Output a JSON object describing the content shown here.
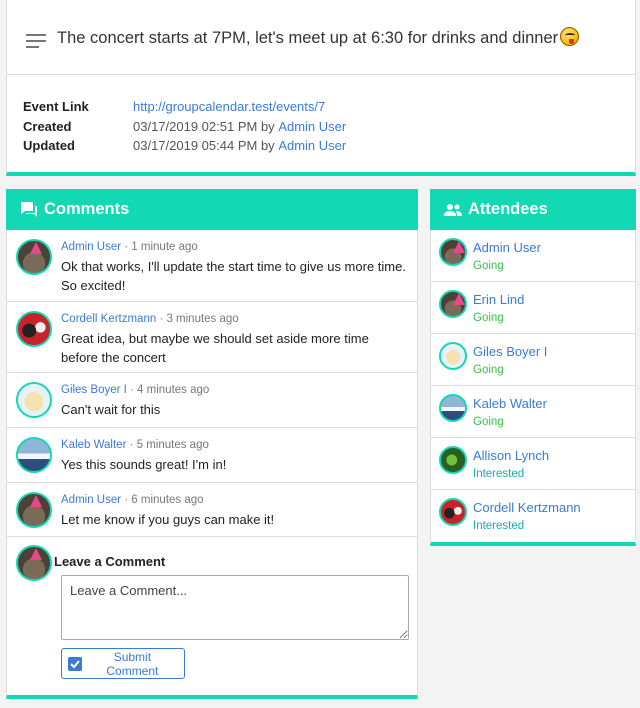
{
  "event": {
    "description": "The concert starts at 7PM, let's meet up at 6:30 for drinks and dinner",
    "details": [
      {
        "label": "Event Link",
        "value": "http://groupcalendar.test/events/7"
      },
      {
        "label": "Created",
        "date": "03/17/2019 02:51 PM",
        "by": "by",
        "user": "Admin User"
      },
      {
        "label": "Updated",
        "date": "03/17/2019 05:44 PM",
        "by": "by",
        "user": "Admin User"
      }
    ]
  },
  "comments": {
    "title": "Comments",
    "items": [
      {
        "author": "Admin User",
        "time": " · 1 minute ago",
        "text": "Ok that works, I'll update the start time to give us more time. So excited!",
        "avatar": "cat-icon"
      },
      {
        "author": "Cordell Kertzmann",
        "time": " · 3 minutes ago",
        "text": "Great idea, but maybe we should set aside more time before the concert",
        "avatar": "red-icon"
      },
      {
        "author": "Giles Boyer I",
        "time": " · 4 minutes ago",
        "text": "Can't wait for this",
        "avatar": "dog-icon"
      },
      {
        "author": "Kaleb Walter",
        "time": " · 5 minutes ago",
        "text": "Yes this sounds great! I'm in!",
        "avatar": "boat-icon"
      },
      {
        "author": "Admin User",
        "time": " · 6 minutes ago",
        "text": "Let me know if you guys can make it!",
        "avatar": "cat-icon"
      }
    ],
    "leave_title": "Leave a Comment",
    "placeholder": "Leave a Comment...",
    "submit_label": "Submit Comment"
  },
  "attendees": {
    "title": "Attendees",
    "items": [
      {
        "name": "Admin User",
        "status": "Going"
      },
      {
        "name": "Erin Lind",
        "status": "Going"
      },
      {
        "name": "Giles Boyer I",
        "status": "Going"
      },
      {
        "name": "Kaleb Walter",
        "status": "Going"
      },
      {
        "name": "Allison Lynch",
        "status": "Interested"
      },
      {
        "name": "Cordell Kertzmann",
        "status": "Interested"
      }
    ]
  },
  "colors": {
    "accent": "#12d8b4",
    "link": "#3a7bd5",
    "going": "#3cc04d",
    "interested": "#17a8bb"
  }
}
